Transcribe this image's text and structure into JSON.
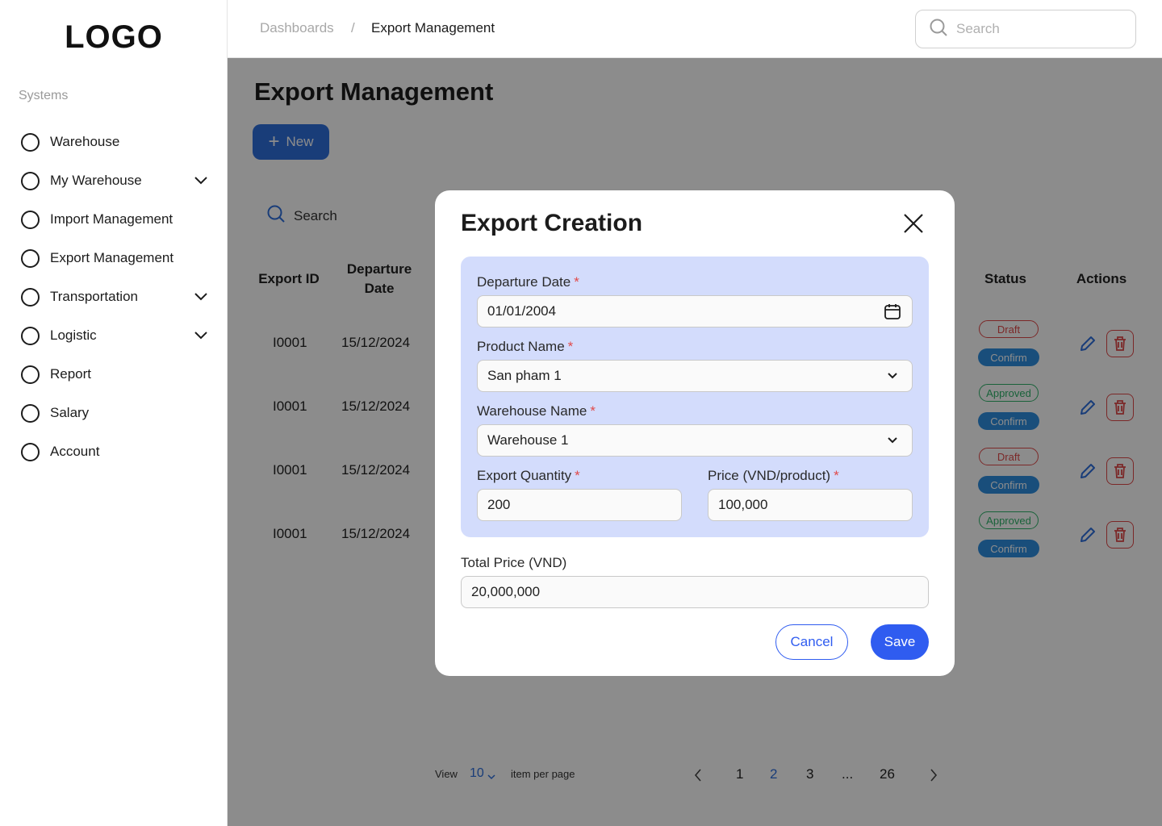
{
  "sidebar": {
    "logo": "LOGO",
    "section_label": "Systems",
    "items": [
      {
        "label": "Warehouse",
        "has_chevron": false
      },
      {
        "label": "My Warehouse",
        "has_chevron": true
      },
      {
        "label": "Import Management",
        "has_chevron": false
      },
      {
        "label": "Export Management",
        "has_chevron": false
      },
      {
        "label": "Transportation",
        "has_chevron": true
      },
      {
        "label": "Logistic",
        "has_chevron": true
      },
      {
        "label": "Report",
        "has_chevron": false
      },
      {
        "label": "Salary",
        "has_chevron": false
      },
      {
        "label": "Account",
        "has_chevron": false
      }
    ]
  },
  "header": {
    "breadcrumb": [
      "Dashboards",
      "/",
      "Export Management"
    ],
    "search_placeholder": "Search"
  },
  "main": {
    "title": "Export Management",
    "new_button_label": "New",
    "search_label": "Search",
    "columns": {
      "export_id": "Export ID",
      "departure_date": "Departure\nDate",
      "status": "Status",
      "actions": "Actions"
    },
    "rows": [
      {
        "export_id": "I0001",
        "departure_date": "15/12/2024",
        "status": "Draft",
        "confirm": "Confirm"
      },
      {
        "export_id": "I0001",
        "departure_date": "15/12/2024",
        "status": "Approved",
        "confirm": "Confirm"
      },
      {
        "export_id": "I0001",
        "departure_date": "15/12/2024",
        "status": "Draft",
        "confirm": "Confirm"
      },
      {
        "export_id": "I0001",
        "departure_date": "15/12/2024",
        "status": "Approved",
        "confirm": "Confirm"
      }
    ],
    "pagination": {
      "view_label": "View",
      "per_page": "10",
      "per_page_suffix": "item per page",
      "pages": [
        "1",
        "2",
        "3",
        "...",
        "26"
      ],
      "current_page": "2"
    }
  },
  "modal": {
    "title": "Export Creation",
    "departure_date_label": "Departure Date",
    "departure_date_value": "01/01/2004",
    "product_name_label": "Product Name",
    "product_name_value": "San pham 1",
    "warehouse_name_label": "Warehouse Name",
    "warehouse_name_value": "Warehouse 1",
    "export_quantity_label": "Export Quantity",
    "export_quantity_value": "200",
    "price_label": "Price (VND/product)",
    "price_value": "100,000",
    "total_price_label": "Total Price (VND)",
    "total_price_value": "20,000,000",
    "required_marker": "*",
    "cancel_label": "Cancel",
    "save_label": "Save"
  },
  "colors": {
    "primary": "#2f5cf0",
    "form_panel": "#d3dcfc",
    "danger": "#e14a4a",
    "success": "#2fb36a",
    "overlay": "rgba(0,0,0,0.45)"
  }
}
